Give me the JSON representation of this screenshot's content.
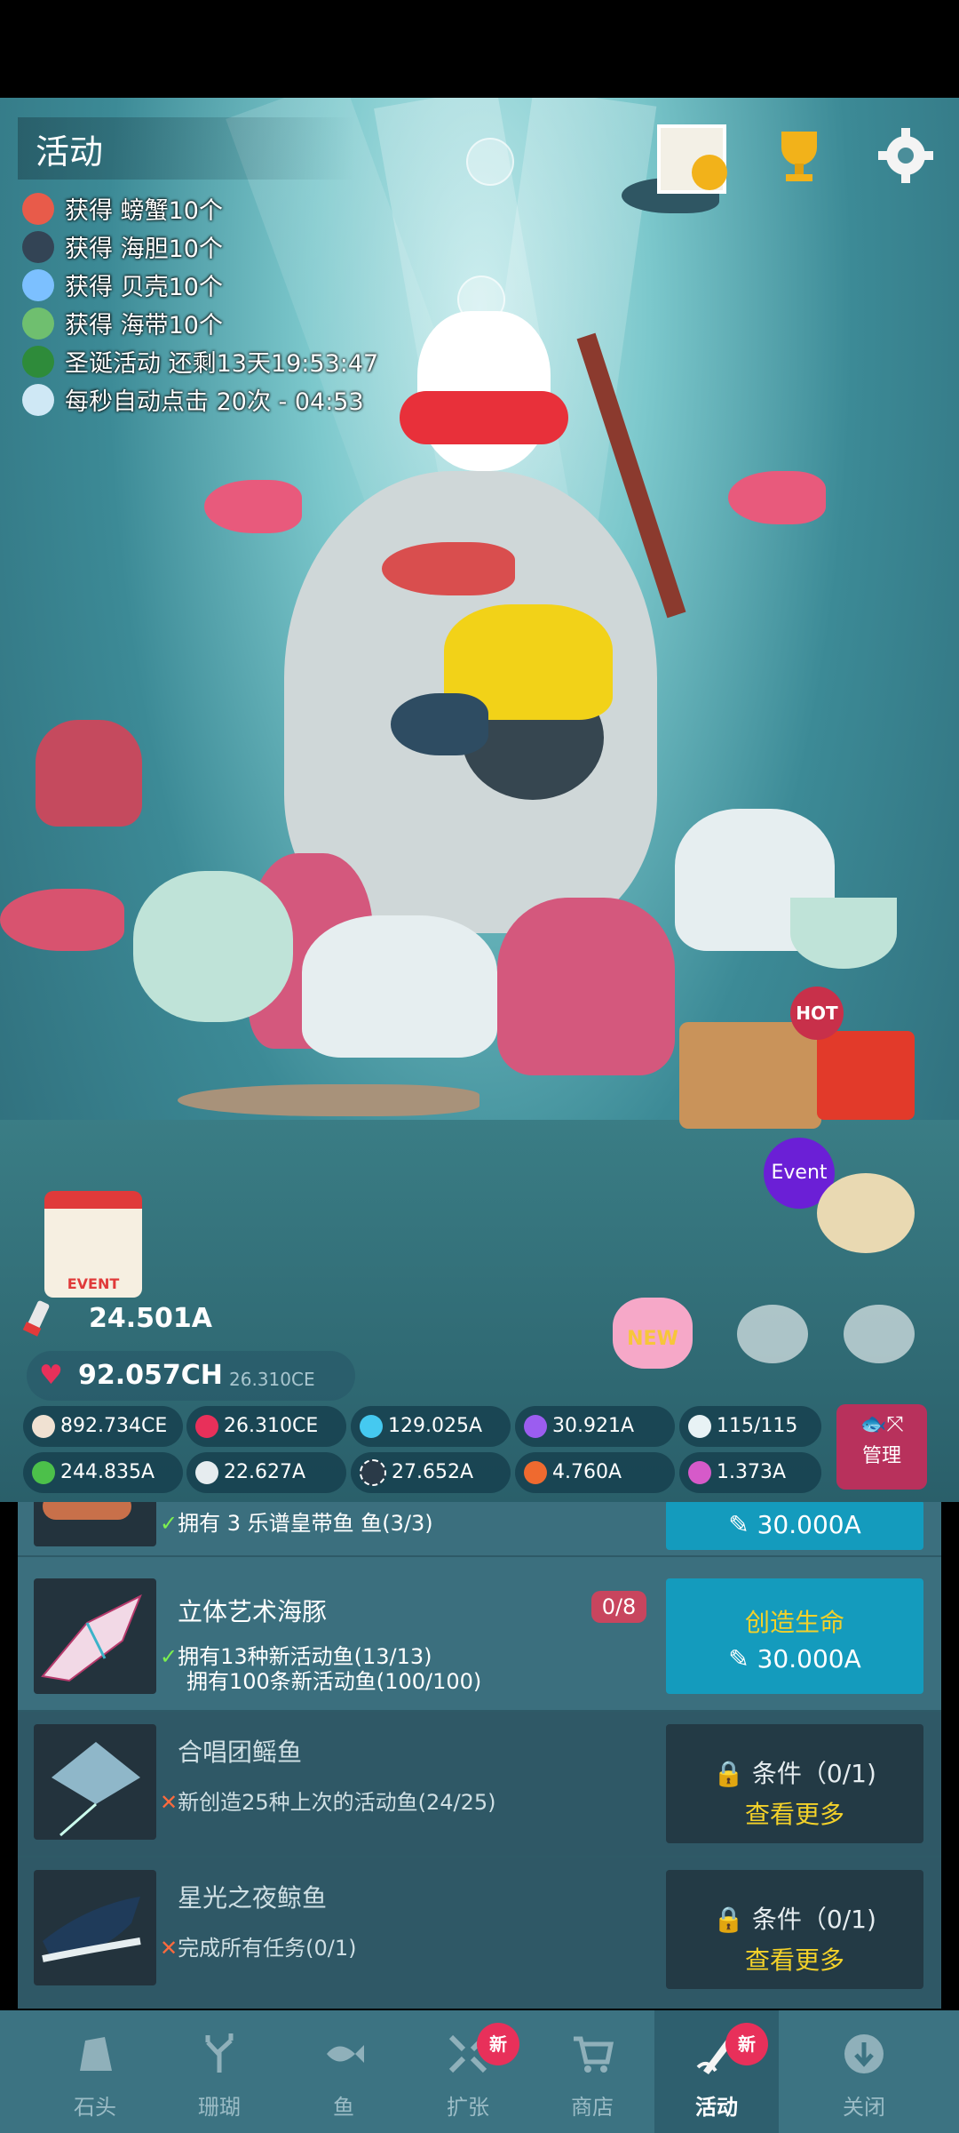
{
  "header": {
    "title": "活动"
  },
  "log": [
    {
      "text": "获得 螃蟹10个",
      "icon": "crab-icon",
      "color": "#e85b4a"
    },
    {
      "text": "获得 海胆10个",
      "icon": "urchin-icon",
      "color": "#334455"
    },
    {
      "text": "获得 贝壳10个",
      "icon": "shell-icon",
      "color": "#7cc0ff"
    },
    {
      "text": "获得 海带10个",
      "icon": "kelp-icon",
      "color": "#6fbf6f"
    },
    {
      "text": "圣诞活动 还剩13天19:53:47",
      "icon": "christmas-tree-icon",
      "color": "#2e8b3a"
    },
    {
      "text": "每秒自动点击 20次 - 04:53",
      "icon": "cloud-icon",
      "color": "#cfe8f5"
    }
  ],
  "scene_badges": {
    "event_label": "Event",
    "hot_label": "HOT",
    "calendar_label": "EVENT",
    "new_label": "NEW"
  },
  "stats": {
    "currency_top": "24.501A",
    "hearts": "92.057CH",
    "hearts_rate": "26.310CE",
    "tap": "892.734CE",
    "heart_rate": "26.310CE",
    "diamonds": "129.025A",
    "pearls": "30.921A",
    "fish_count": "115/115",
    "kelp": "244.835A",
    "shells": "22.627A",
    "urchin": "27.652A",
    "crab": "4.760A",
    "seahorse": "1.373A",
    "manage_label": "管理"
  },
  "list": [
    {
      "title": "",
      "cond1": "拥有 3 乐谱皇带鱼 鱼(3/3)",
      "cond1_ok": true,
      "btn_title": "",
      "btn_price": "30.000A"
    },
    {
      "title": "立体艺术海豚",
      "counter": "0/8",
      "cond1": "拥有13种新活动鱼(13/13)",
      "cond2": "拥有100条新活动鱼(100/100)",
      "btn_title": "创造生命",
      "btn_price": "30.000A"
    },
    {
      "title": "合唱团鳐鱼",
      "cond1": "新创造25种上次的活动鱼(24/25)",
      "btn_title": "条件（0/1)",
      "btn_more": "查看更多"
    },
    {
      "title": "星光之夜鲸鱼",
      "cond1": "完成所有任务(0/1)",
      "btn_title": "条件（0/1)",
      "btn_more": "查看更多"
    }
  ],
  "nav": [
    {
      "label": "石头",
      "icon": "rock-icon"
    },
    {
      "label": "珊瑚",
      "icon": "coral-icon"
    },
    {
      "label": "鱼",
      "icon": "fish-icon"
    },
    {
      "label": "扩张",
      "icon": "expand-icon",
      "badge": "新"
    },
    {
      "label": "商店",
      "icon": "cart-icon"
    },
    {
      "label": "活动",
      "icon": "event-icon",
      "badge": "新",
      "active": true
    },
    {
      "label": "关闭",
      "icon": "close-arrow-icon"
    }
  ]
}
